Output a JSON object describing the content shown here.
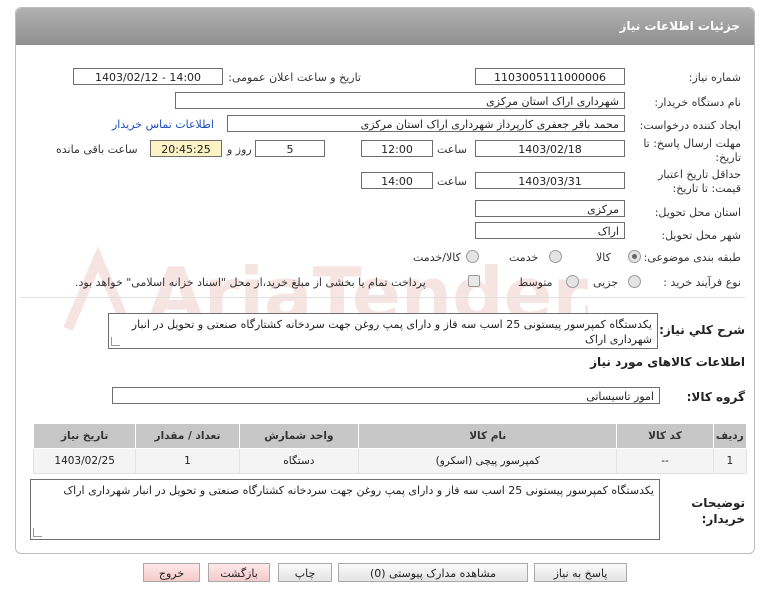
{
  "panel_title": "جزئیات اطلاعات نیاز",
  "fields": {
    "need_number_label": "شماره نیاز:",
    "need_number": "1103005111000006",
    "announce_label": "تاریخ و ساعت اعلان عمومی:",
    "announce_value": "1403/02/12 - 14:00",
    "buyer_org_label": "نام دستگاه خریدار:",
    "buyer_org": "شهرداری اراک استان مرکزی",
    "creator_label": "ایجاد کننده درخواست:",
    "creator": "محمد باقر جعفری کارپرداز شهرداری اراک استان مرکزی",
    "contact_link": "اطلاعات تماس خریدار",
    "deadline_label_1": "مهلت ارسال پاسخ: تا",
    "deadline_label_2": "تاریخ:",
    "deadline_date": "1403/02/18",
    "time_label": "ساعت",
    "deadline_time": "12:00",
    "days_value": "5",
    "days_label": "روز و",
    "remaining_time": "20:45:25",
    "remaining_label": "ساعت باقی مانده",
    "validity_label_1": "حداقل تاریخ اعتبار",
    "validity_label_2": "قیمت: تا تاریخ:",
    "validity_date": "1403/03/31",
    "validity_time": "14:00",
    "province_label": "استان محل تحویل:",
    "province": "مرکزی",
    "city_label": "شهر محل تحویل:",
    "city": "اراک",
    "category_label": "طبقه بندی موضوعی:",
    "category_options": [
      "کالا",
      "خدمت",
      "کالا/خدمت"
    ],
    "process_label": "نوع فرآیند خرید :",
    "process_options": [
      "جزیی",
      "متوسط"
    ],
    "payment_note": "پرداخت تمام یا بخشی از مبلغ خرید،از محل \"اسناد خزانه اسلامی\" خواهد بود."
  },
  "description": {
    "label": "شرح کلي نياز:",
    "text": "یکدستگاه کمپرسور پیستونی 25 اسب سه فاز و دارای پمپ روغن جهت سردخانه کشتارگاه صنعتی و تحویل در انبار شهرداری اراک"
  },
  "goods_section_title": "اطلاعات کالاهای مورد نیاز",
  "goods_group": {
    "label": "گروه کالا:",
    "value": "امور تاسیساتی"
  },
  "table": {
    "headers": [
      "ردیف",
      "کد کالا",
      "نام کالا",
      "واحد شمارش",
      "تعداد / مقدار",
      "تاریخ نیاز"
    ],
    "rows": [
      [
        "1",
        "--",
        "کمپرسور پیچی (اسکرو)",
        "دستگاه",
        "1",
        "1403/02/25"
      ]
    ]
  },
  "buyer_notes": {
    "label_1": "توضیحات",
    "label_2": "خریدار:",
    "text": "یکدستگاه کمپرسور پیستونی 25 اسب سه فاز و دارای پمپ روغن جهت سردخانه کشتارگاه صنعتی و تحویل در انبار شهرداری اراک"
  },
  "buttons": {
    "reply": "پاسخ به نیاز",
    "attachments": "مشاهده مدارک پیوستی (0)",
    "print": "چاپ",
    "back": "بازگشت",
    "exit": "خروج"
  },
  "watermark": "AriaTender.net",
  "colors": {
    "header": "#9e9e9e",
    "link": "#1a4fbf",
    "remaining_bg": "#fbf3c4",
    "exit_bg": "#f5c9c9"
  }
}
